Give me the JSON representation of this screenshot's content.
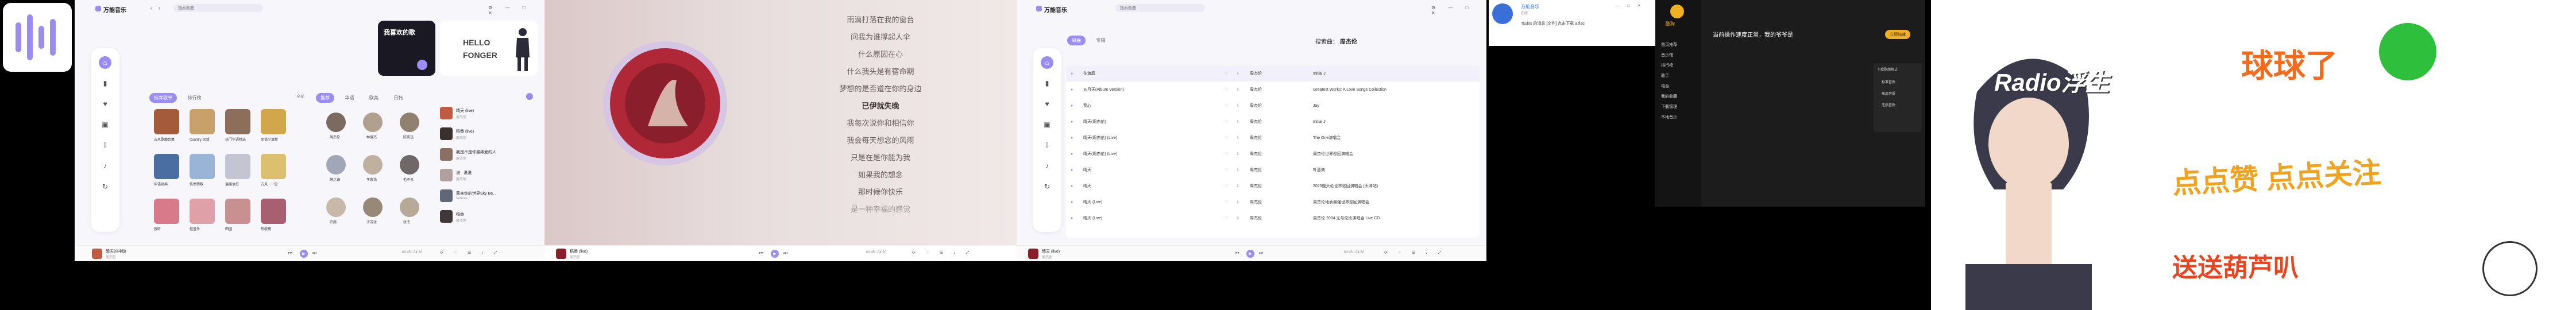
{
  "app": {
    "name": "万能音乐",
    "search_placeholder": "搜索歌曲",
    "accent": "#9b8cf2"
  },
  "banner": {
    "title": "我喜欢的歌",
    "hello1": "HELLO",
    "hello2": "FONGER"
  },
  "tabs": {
    "recommend": "推荐歌单",
    "rank": "排行榜",
    "more": "全部"
  },
  "playlists": [
    {
      "cap": "古风歌曲合集"
    },
    {
      "cap": "Country 民谣"
    },
    {
      "cap": "热门华语精选"
    },
    {
      "cap": "民谣小清新"
    },
    {
      "cap": "华语经典"
    },
    {
      "cap": "伤感情歌"
    },
    {
      "cap": "温暖治愈"
    },
    {
      "cap": "古风 · 一念"
    },
    {
      "cap": "夜听"
    },
    {
      "cap": "轻音乐"
    },
    {
      "cap": "田园"
    },
    {
      "cap": "热歌榜"
    }
  ],
  "artists_tab": {
    "a": "推荐",
    "b": "华语",
    "c": "欧美",
    "d": "日韩"
  },
  "artists": [
    {
      "name": "周杰伦"
    },
    {
      "name": "林俊杰"
    },
    {
      "name": "陈奕迅"
    },
    {
      "name": "薛之谦"
    },
    {
      "name": "李荣浩"
    },
    {
      "name": "毛不易"
    },
    {
      "name": "许嵩"
    },
    {
      "name": "汪苏泷"
    },
    {
      "name": "张杰"
    }
  ],
  "right_list": [
    {
      "title": "晴天 (live)",
      "sub": "周杰伦"
    },
    {
      "title": "稻香 (live)",
      "sub": "周杰伦"
    },
    {
      "title": "我是不是你最疼爱的人",
      "sub": "周杰伦"
    },
    {
      "title": "说 · 说说",
      "sub": "周杰伦"
    },
    {
      "title": "置身你的世界Sky Be...",
      "sub": "Various"
    },
    {
      "title": "稻香",
      "sub": "周杰伦"
    }
  ],
  "player1": {
    "title": "晴天的冲动",
    "artist": "周杰伦",
    "time": "00:45 / 04:20"
  },
  "lyrics": [
    "雨滴打落在我的窗台",
    "问我为谁撑起人伞",
    "什么原因在心",
    "什么我头是有宿命期",
    "梦想的是否道在你的身边",
    "已伊就失晚",
    "我每次说你和相信你",
    "我会每天想念的风雨",
    "只是在是你能为我",
    "如果我的想念",
    "那时候你快乐",
    "是一种幸福的感觉"
  ],
  "player2": {
    "title": "稻香 (live)",
    "artist": "周杰伦",
    "time": "00:45 / 04:20"
  },
  "songs_page": {
    "tab_a": "单曲",
    "tab_b": "专辑",
    "search_label": "搜索曲：",
    "search_value": "周杰伦"
  },
  "songs": [
    {
      "title": "花海庭",
      "artist": "周杰伦",
      "album": "Initial J"
    },
    {
      "title": "五月天(Album Version)",
      "artist": "周杰伦",
      "album": "Greatest Works: A Love Songs Collection"
    },
    {
      "title": "我心",
      "artist": "周杰伦",
      "album": "Jay"
    },
    {
      "title": "晴天(周杰伦)",
      "artist": "周杰伦",
      "album": "Initial J"
    },
    {
      "title": "晴天(周杰伦) (Live)",
      "artist": "周杰伦",
      "album": "The One演唱会"
    },
    {
      "title": "晴天(周杰伦) (Live)",
      "artist": "周杰伦",
      "album": "周杰伦世界巡回演唱会"
    },
    {
      "title": "晴天",
      "artist": "周杰伦",
      "album": "叶惠美"
    },
    {
      "title": "晴天",
      "artist": "周杰伦",
      "album": "2023魔天伦世界巡回演唱会 (天津站)"
    },
    {
      "title": "晴天 (Live)",
      "artist": "周杰伦",
      "album": "周杰伦地表最强世界巡回演唱会"
    },
    {
      "title": "晴天 (Live)",
      "artist": "周杰伦",
      "album": "周杰伦 2004 无与伦比演唱会 Live CD"
    }
  ],
  "player3": {
    "title": "晴天 (live)",
    "artist": "周杰伦",
    "time": "00:45 / 04:20"
  },
  "qq": {
    "name": "万能音乐",
    "status": "在线",
    "msg": "Tsukis 的消息 [文件] 点击下载 a.flac"
  },
  "kuwo": {
    "brand": "酷狗",
    "headline": "当前操作速度正常，我的爷爷是",
    "button": "立即加速",
    "menu": [
      "首页推荐",
      "音乐馆",
      "排行榜",
      "歌手",
      "电台",
      "我的收藏",
      "下载管理",
      "本地音乐"
    ],
    "panel_title": "下载歌曲格式",
    "options": [
      "标准音质",
      "高品音质",
      "无损音质"
    ]
  },
  "art": {
    "name": "Radio浮生",
    "top": "球球了",
    "mid": "点点赞 点点关注",
    "bot": "送送葫芦叭"
  }
}
